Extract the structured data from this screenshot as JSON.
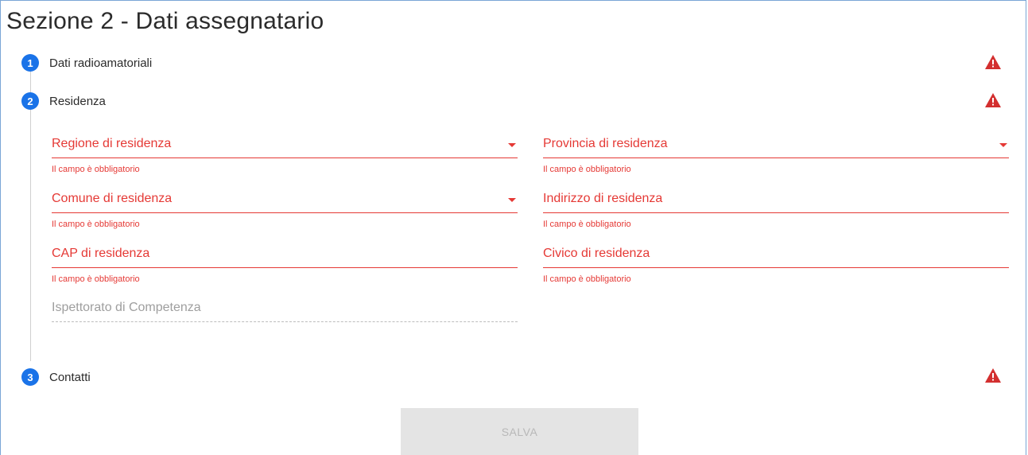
{
  "page": {
    "title": "Sezione 2 - Dati assegnatario"
  },
  "steps": [
    {
      "number": "1",
      "label": "Dati radioamatoriali",
      "icon": "warning-icon"
    },
    {
      "number": "2",
      "label": "Residenza",
      "icon": "warning-icon"
    },
    {
      "number": "3",
      "label": "Contatti",
      "icon": "warning-icon"
    }
  ],
  "residenza": {
    "regione": {
      "label": "Regione di residenza",
      "error": "Il campo è obbligatorio"
    },
    "provincia": {
      "label": "Provincia di residenza",
      "error": "Il campo è obbligatorio"
    },
    "comune": {
      "label": "Comune di residenza",
      "error": "Il campo è obbligatorio"
    },
    "indirizzo": {
      "label": "Indirizzo di residenza",
      "error": "Il campo è obbligatorio"
    },
    "cap": {
      "label": "CAP di residenza",
      "error": "Il campo è obbligatorio"
    },
    "civico": {
      "label": "Civico di residenza",
      "error": "Il campo è obbligatorio"
    },
    "ispettorato": {
      "label": "Ispettorato di Competenza"
    }
  },
  "actions": {
    "save_label": "SALVA"
  },
  "colors": {
    "accent": "#1a73e8",
    "error": "#e53935",
    "warning": "#d32f2f"
  }
}
